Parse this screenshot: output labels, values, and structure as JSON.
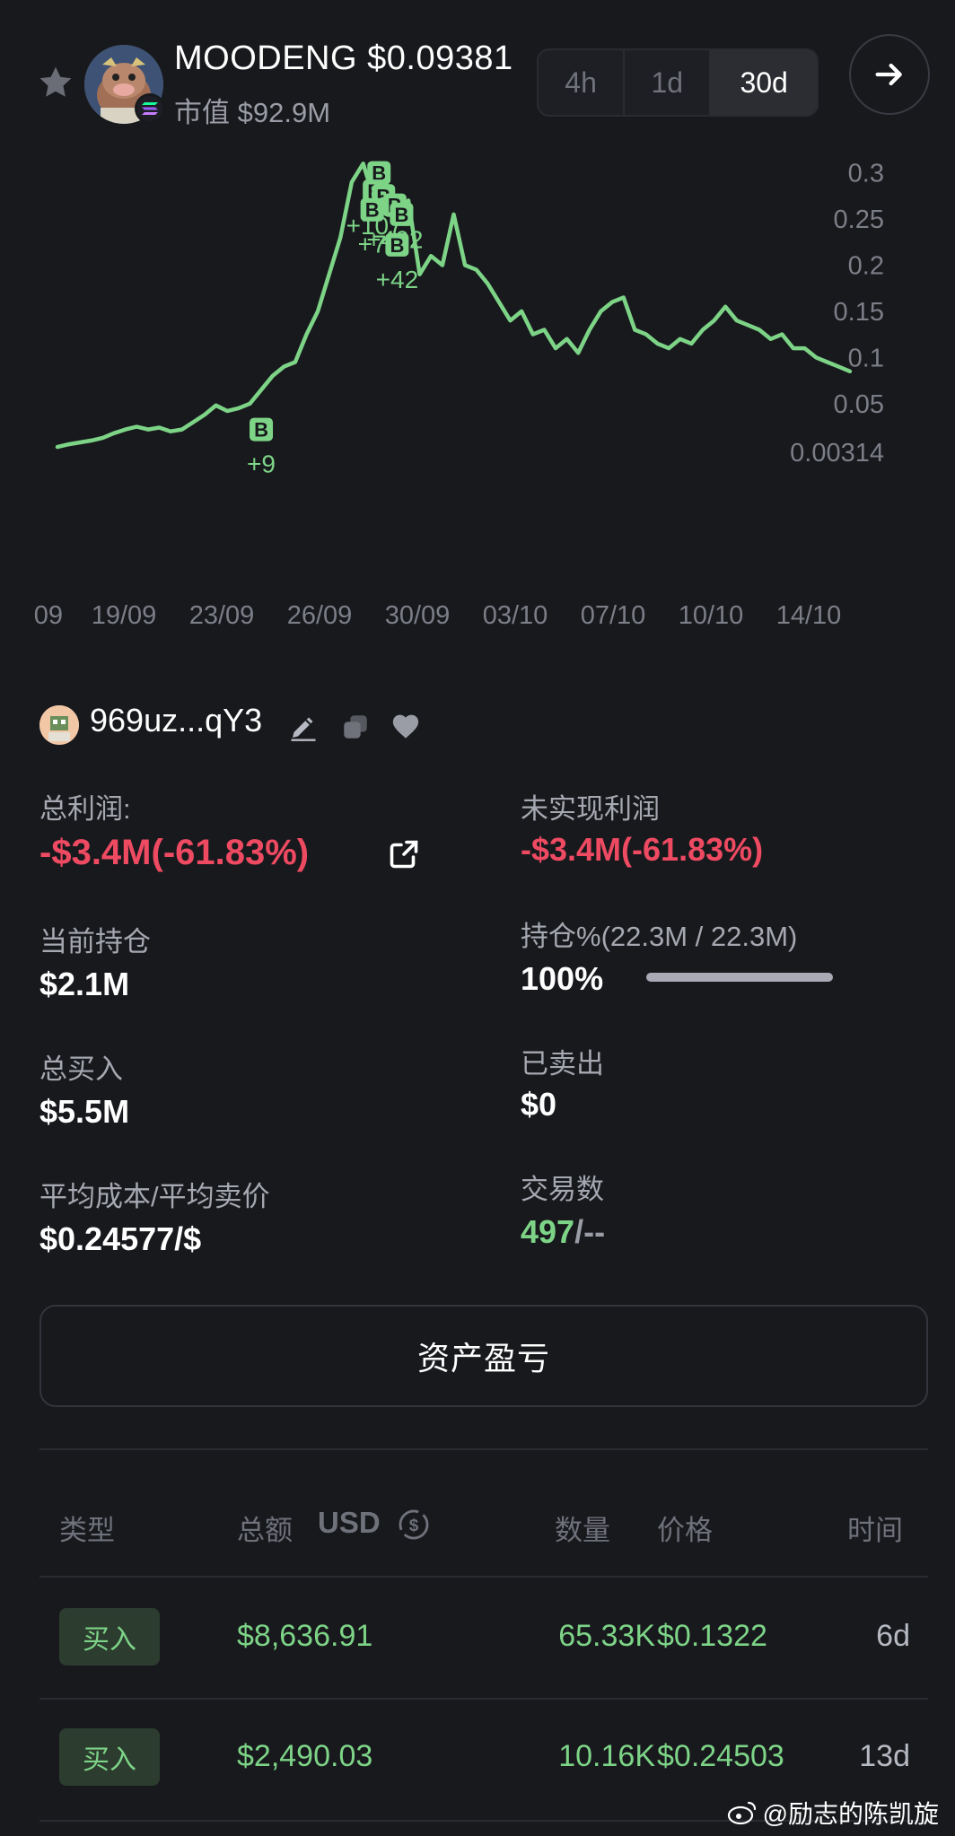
{
  "header": {
    "title": "MOODENG $0.09381",
    "market_cap": "市值 $92.9M",
    "timeframes": [
      {
        "label": "4h",
        "active": false
      },
      {
        "label": "1d",
        "active": false
      },
      {
        "label": "30d",
        "active": true
      }
    ],
    "icons": {
      "favorite": "star-icon",
      "chain": "solana-icon",
      "navigate": "arrow-right-icon"
    }
  },
  "chart_data": {
    "type": "line",
    "title": "",
    "xlabel": "",
    "ylabel": "",
    "color": "#7dd487",
    "y_tick_labels": [
      "0.3",
      "0.25",
      "0.2",
      "0.15",
      "0.1",
      "0.05",
      "0.00314"
    ],
    "y_ticks": [
      0.3,
      0.25,
      0.2,
      0.15,
      0.1,
      0.05,
      0.00314
    ],
    "ylim": [
      0.00314,
      0.32
    ],
    "x_tick_labels": [
      "09",
      "19/09",
      "23/09",
      "26/09",
      "30/09",
      "03/10",
      "07/10",
      "10/10",
      "14/10"
    ],
    "x": [
      0,
      0.5,
      1,
      1.5,
      2,
      2.5,
      3,
      3.5,
      4,
      4.5,
      5,
      5.5,
      6,
      6.5,
      7,
      7.5,
      8,
      8.5,
      9,
      9.5,
      10,
      10.5,
      11,
      11.5,
      12,
      12.5,
      13,
      13.5,
      14,
      14.5,
      15,
      15.5,
      16,
      16.5,
      17,
      17.5,
      18,
      18.5,
      19,
      19.5,
      20,
      20.5,
      21,
      21.5,
      22,
      22.5,
      23,
      23.5,
      24,
      24.5,
      25,
      25.5,
      26,
      26.5,
      27,
      27.5,
      28,
      28.5,
      29,
      29.5,
      30,
      30.5,
      31,
      31.5,
      32,
      32.5,
      33,
      33.5,
      34,
      34.5,
      35
    ],
    "y": [
      0.003,
      0.006,
      0.008,
      0.01,
      0.013,
      0.018,
      0.022,
      0.025,
      0.022,
      0.024,
      0.02,
      0.022,
      0.03,
      0.038,
      0.048,
      0.042,
      0.045,
      0.05,
      0.065,
      0.08,
      0.09,
      0.095,
      0.125,
      0.15,
      0.19,
      0.23,
      0.29,
      0.31,
      0.27,
      0.29,
      0.25,
      0.27,
      0.19,
      0.21,
      0.2,
      0.255,
      0.2,
      0.195,
      0.18,
      0.16,
      0.14,
      0.15,
      0.125,
      0.13,
      0.11,
      0.12,
      0.105,
      0.13,
      0.15,
      0.16,
      0.165,
      0.13,
      0.125,
      0.115,
      0.11,
      0.12,
      0.115,
      0.13,
      0.14,
      0.155,
      0.14,
      0.135,
      0.13,
      0.12,
      0.125,
      0.11,
      0.11,
      0.1,
      0.095,
      0.09,
      0.085
    ],
    "x_domain": [
      0,
      37.5
    ],
    "trade_markers": [
      {
        "label": "B",
        "x": 9.0,
        "y": 0.022,
        "annotation": "+9"
      },
      {
        "label": "B",
        "x": 14.2,
        "y": 0.3,
        "annotation": ""
      },
      {
        "label": "B",
        "x": 14.0,
        "y": 0.28,
        "annotation": "+107"
      },
      {
        "label": "B",
        "x": 14.4,
        "y": 0.275,
        "annotation": ""
      },
      {
        "label": "B",
        "x": 14.9,
        "y": 0.265,
        "annotation": "+402"
      },
      {
        "label": "B",
        "x": 13.9,
        "y": 0.26,
        "annotation": "+7"
      },
      {
        "label": "B",
        "x": 15.2,
        "y": 0.255,
        "annotation": ""
      },
      {
        "label": "B",
        "x": 15.0,
        "y": 0.222,
        "annotation": "+42"
      }
    ],
    "grid": false,
    "legend": "none"
  },
  "wallet": {
    "address": "969uz...qY3",
    "icons": [
      "edit-icon",
      "copy-icon",
      "heart-icon"
    ]
  },
  "stats": {
    "total_profit_label": "总利润:",
    "total_profit_value": "-$3.4M(-61.83%)",
    "unrealized_label": "未实现利润",
    "unrealized_value": "-$3.4M(-61.83%)",
    "holding_label": "当前持仓",
    "holding_value": "$2.1M",
    "holding_pct_label": "持仓%(22.3M / 22.3M)",
    "holding_pct_value": "100%",
    "holding_pct_fraction": 1.0,
    "total_buy_label": "总买入",
    "total_buy_value": "$5.5M",
    "sold_label": "已卖出",
    "sold_value": "$0",
    "avg_label": "平均成本/平均卖价",
    "avg_value": "$0.24577/$",
    "trades_label": "交易数",
    "trades_count": "497",
    "trades_sep": "/--"
  },
  "pnl_button": "资产盈亏",
  "table": {
    "headers": {
      "type": "类型",
      "total": "总额",
      "currency": "USD",
      "qty": "数量",
      "price": "价格",
      "time": "时间"
    },
    "rows": [
      {
        "type": "买入",
        "total": "$8,636.91",
        "qty": "65.33K",
        "price": "$0.1322",
        "time": "6d"
      },
      {
        "type": "买入",
        "total": "$2,490.03",
        "qty": "10.16K",
        "price": "$0.24503",
        "time": "13d"
      }
    ]
  },
  "watermark": "@励志的陈凯旋"
}
